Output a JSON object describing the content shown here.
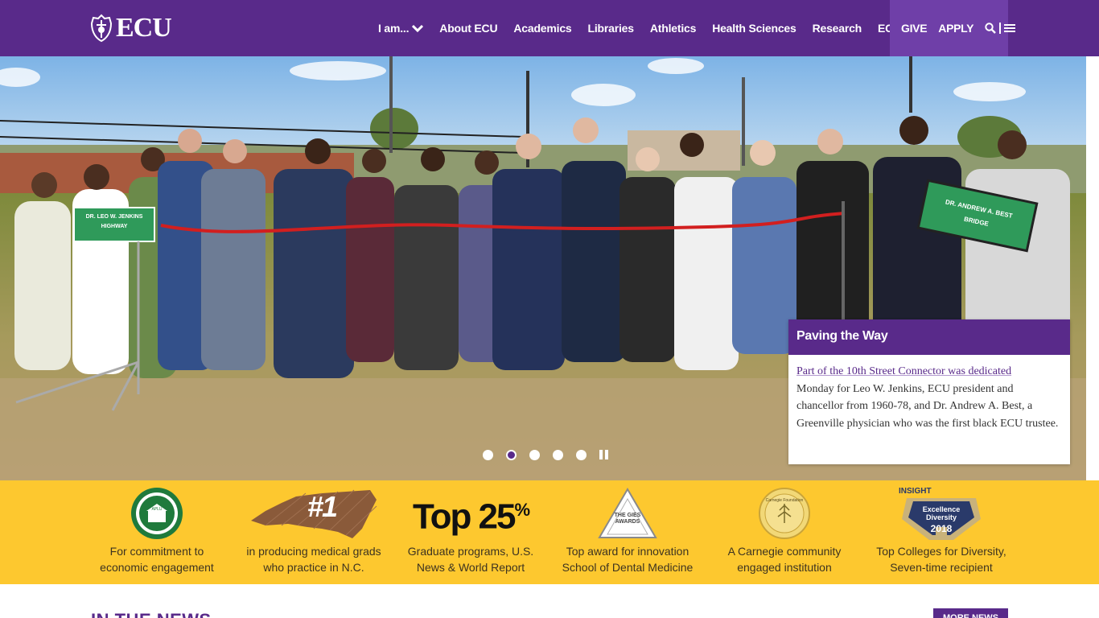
{
  "header": {
    "logo_text": "ECU",
    "nav": [
      {
        "label": "I am..."
      },
      {
        "label": "About ECU"
      },
      {
        "label": "Academics"
      },
      {
        "label": "Libraries"
      },
      {
        "label": "Athletics"
      },
      {
        "label": "Health Sciences"
      },
      {
        "label": "Research"
      },
      {
        "label": "ECUArts"
      }
    ],
    "give_label": "GIVE",
    "apply_label": "APPLY",
    "icons": [
      "search-icon",
      "menu-icon"
    ]
  },
  "hero": {
    "image_description": "Ribbon-cutting photo",
    "sign_left": {
      "line1": "DR. LEO W. JENKINS",
      "line2": "HIGHWAY"
    },
    "sign_right": {
      "line1": "DR. ANDREW A. BEST",
      "line2": "BRIDGE"
    },
    "caption_title": "Paving the Way",
    "caption_link": "Part of the 10th Street Connector was dedicated",
    "caption_text": "Monday for Leo W. Jenkins, ECU president and chancellor from 1960-78, and Dr. Andrew A. Best, a Greenville physician who was the first black ECU trustee.",
    "slides": 5,
    "active_slide": 2
  },
  "rankings": [
    {
      "icon": "aplu-seal-icon",
      "line1": "For commitment to",
      "line2": "economic engagement"
    },
    {
      "icon": "nc-map-number-one-icon",
      "badge": "#1",
      "line1": "in producing medical grads",
      "line2": "who practice in N.C."
    },
    {
      "icon": "top-25-icon",
      "badge": "Top 25",
      "badge_sup": "%",
      "line1": "Graduate programs, U.S.",
      "line2": "News & World Report"
    },
    {
      "icon": "gies-awards-icon",
      "badge": "THE GIES AWARDS",
      "line1": "Top award for innovation",
      "line2": "School of Dental Medicine"
    },
    {
      "icon": "carnegie-seal-icon",
      "badge": "Carnegie Foundation",
      "line1": "A Carnegie community",
      "line2": "engaged institution"
    },
    {
      "icon": "insight-diversity-award-icon",
      "badge_top": "INSIGHT",
      "badge_mid1": "Excellence",
      "badge_mid2": "Diversity",
      "badge_year": "2018",
      "line1": "Top Colleges for Diversity,",
      "line2": "Seven-time recipient"
    }
  ],
  "news": {
    "title": "IN THE NEWS",
    "button_label": "MORE NEWS"
  },
  "colors": {
    "primary_purple": "#592a8a",
    "light_purple": "#6f3fa8",
    "gold": "#fdc82f"
  }
}
